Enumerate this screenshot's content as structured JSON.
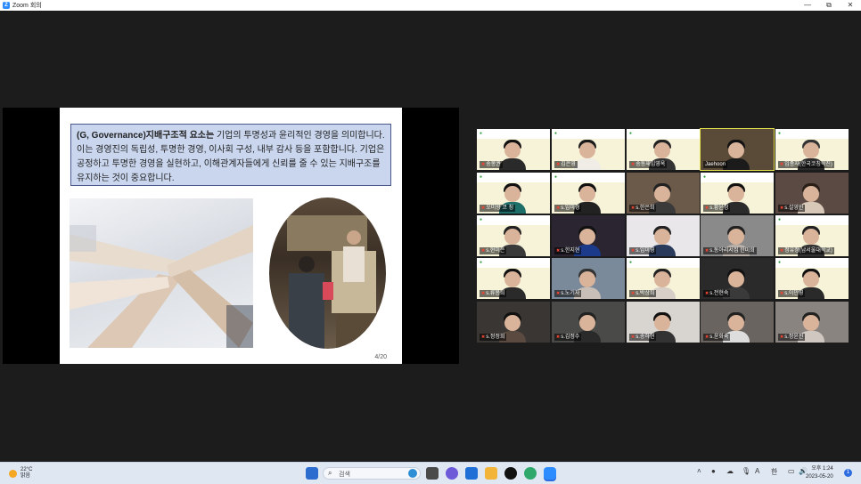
{
  "window": {
    "title": "Zoom 회의",
    "minimize": "—",
    "restore": "⧉",
    "close": "✕"
  },
  "slide": {
    "heading_bold": "(G, Governance)지배구조적 요소는",
    "text": " 기업의 투명성과 윤리적인 경영을 의미합니다. 이는 경영진의 독립성, 투명한 경영, 이사회 구성, 내부 감사 등을 포함합니다. 기업은 공정하고 투명한 경영을 실현하고, 이해관계자들에게 신뢰를 줄 수 있는 지배구조를 유지하는 것이 중요합니다.",
    "page": "4/20"
  },
  "participants": [
    {
      "name": "송봉권",
      "bg": "#f2f0d8",
      "slide": true,
      "hair": "#111",
      "body": "#2a2a2a"
    },
    {
      "name": "김은영",
      "bg": "#f2f0d8",
      "slide": true,
      "hair": "#1a1a1a",
      "body": "#f0ede6"
    },
    {
      "name": "송동재임영옥",
      "bg": "#f2f0d8",
      "slide": true,
      "hair": "#222",
      "body": "#333"
    },
    {
      "name": "Jaehoon",
      "bg": "#5a4a38",
      "slide": false,
      "hair": "#111",
      "body": "#1b1b1b",
      "label_plain": true
    },
    {
      "name": "임종자(한국코칭학진)",
      "bg": "#f2f0d8",
      "slide": true,
      "hair": "#333",
      "body": "#2a2a2a"
    },
    {
      "name": "오미향 코 칭",
      "bg": "#f2f0d8",
      "slide": true,
      "hair": "#111",
      "body": "#1e6e6a"
    },
    {
      "name": "s.임미경",
      "bg": "#f2f0d8",
      "slide": true,
      "hair": "#111",
      "body": "#222"
    },
    {
      "name": "s.한은희",
      "bg": "#6b5a4a",
      "slide": false,
      "hair": "#222",
      "body": "#3a3a3a"
    },
    {
      "name": "s.황윤정",
      "bg": "#f2f0d8",
      "slide": true,
      "hair": "#111",
      "body": "#2b2b2b"
    },
    {
      "name": "s.설영민",
      "bg": "#5b4a44",
      "slide": false,
      "hair": "#2a1f18",
      "body": "#d8c8b8"
    },
    {
      "name": "s.현미은",
      "bg": "#f2f0d8",
      "slide": true,
      "hair": "#222",
      "body": "#3a3a3a"
    },
    {
      "name": "s.한지현",
      "bg": "#2a2530",
      "slide": false,
      "hair": "#111",
      "body": "#1b3a8a"
    },
    {
      "name": "s.임미영",
      "bg": "#e9e7ea",
      "slide": false,
      "hair": "#222",
      "body": "#2a3a5a"
    },
    {
      "name": "s.동아리서집 한미희",
      "bg": "#8a8a8a",
      "slide": false,
      "hair": "#222",
      "body": "#b8b0a8"
    },
    {
      "name": "정유정(남서울대학교)",
      "bg": "#f2f0d8",
      "slide": true,
      "hair": "#222",
      "body": "#333"
    },
    {
      "name": "s.류봉희",
      "bg": "#f2f0d8",
      "slide": true,
      "hair": "#111",
      "body": "#2a2a2a"
    },
    {
      "name": "s.노기자",
      "bg": "#7a8a9a",
      "slide": false,
      "hair": "#333",
      "body": "#c8c0b8"
    },
    {
      "name": "s.박상희",
      "bg": "#f2f0d8",
      "slide": true,
      "hair": "#222",
      "body": "#d8d0c8"
    },
    {
      "name": "s.전현숙",
      "bg": "#2a2a2a",
      "slide": false,
      "hair": "#111",
      "body": "#3a3a3a"
    },
    {
      "name": "s.이민영",
      "bg": "#f2f0d8",
      "slide": true,
      "hair": "#111",
      "body": "#2a2a2a"
    },
    {
      "name": "s.정정희",
      "bg": "#3a3634",
      "slide": false,
      "hair": "#111",
      "body": "#5a4a40"
    },
    {
      "name": "s.김정수",
      "bg": "#4a4a48",
      "slide": false,
      "hair": "#222",
      "body": "#2a2a2a"
    },
    {
      "name": "s.송하현",
      "bg": "#d8d4d0",
      "slide": false,
      "hair": "#111",
      "body": "#333"
    },
    {
      "name": "s.윤화숙",
      "bg": "#6a6460",
      "slide": false,
      "hair": "#222",
      "body": "#ddd"
    },
    {
      "name": "s.정윤진",
      "bg": "#8a8480",
      "slide": false,
      "hair": "#222",
      "body": "#d0c8c0"
    }
  ],
  "taskbar": {
    "temp": "22°C",
    "weather": "맑음",
    "search_placeholder": "검색",
    "ime_a": "A",
    "ime_han": "한",
    "time": "오후 1:24",
    "date": "2023-05-20",
    "notif": "1"
  }
}
